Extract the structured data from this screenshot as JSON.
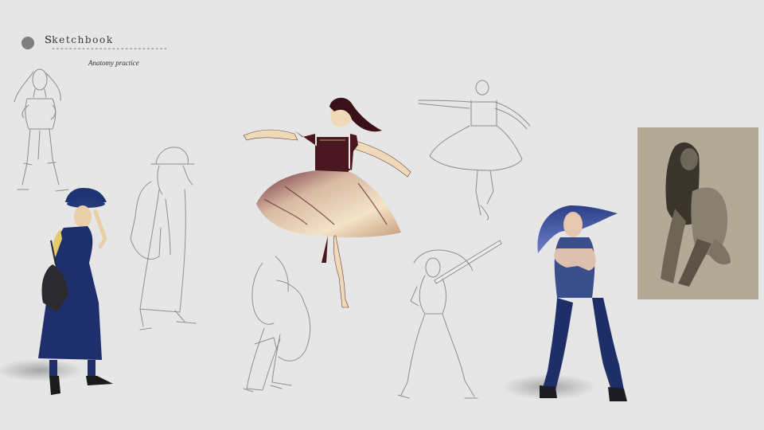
{
  "header": {
    "title_initial": "s",
    "title_rest": "ketchbook",
    "rule": "---------------------------",
    "subtitle": "Anatomy practice"
  },
  "colors": {
    "background": "#e6e6e6",
    "navy": "#1f3573",
    "burgundy": "#4a1620",
    "cream": "#f0d9b9",
    "sepia_card": "#b2a996",
    "pencil": "#8c8c8c"
  },
  "icons": {
    "dot": "gray-circle-icon"
  }
}
